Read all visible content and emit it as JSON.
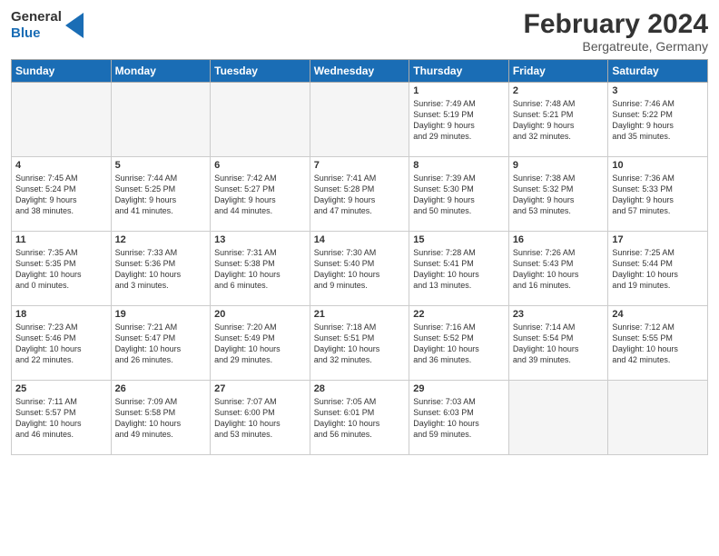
{
  "header": {
    "logo_line1": "General",
    "logo_line2": "Blue",
    "month": "February 2024",
    "location": "Bergatreute, Germany"
  },
  "days_of_week": [
    "Sunday",
    "Monday",
    "Tuesday",
    "Wednesday",
    "Thursday",
    "Friday",
    "Saturday"
  ],
  "weeks": [
    [
      {
        "day": "",
        "info": ""
      },
      {
        "day": "",
        "info": ""
      },
      {
        "day": "",
        "info": ""
      },
      {
        "day": "",
        "info": ""
      },
      {
        "day": "1",
        "info": "Sunrise: 7:49 AM\nSunset: 5:19 PM\nDaylight: 9 hours\nand 29 minutes."
      },
      {
        "day": "2",
        "info": "Sunrise: 7:48 AM\nSunset: 5:21 PM\nDaylight: 9 hours\nand 32 minutes."
      },
      {
        "day": "3",
        "info": "Sunrise: 7:46 AM\nSunset: 5:22 PM\nDaylight: 9 hours\nand 35 minutes."
      }
    ],
    [
      {
        "day": "4",
        "info": "Sunrise: 7:45 AM\nSunset: 5:24 PM\nDaylight: 9 hours\nand 38 minutes."
      },
      {
        "day": "5",
        "info": "Sunrise: 7:44 AM\nSunset: 5:25 PM\nDaylight: 9 hours\nand 41 minutes."
      },
      {
        "day": "6",
        "info": "Sunrise: 7:42 AM\nSunset: 5:27 PM\nDaylight: 9 hours\nand 44 minutes."
      },
      {
        "day": "7",
        "info": "Sunrise: 7:41 AM\nSunset: 5:28 PM\nDaylight: 9 hours\nand 47 minutes."
      },
      {
        "day": "8",
        "info": "Sunrise: 7:39 AM\nSunset: 5:30 PM\nDaylight: 9 hours\nand 50 minutes."
      },
      {
        "day": "9",
        "info": "Sunrise: 7:38 AM\nSunset: 5:32 PM\nDaylight: 9 hours\nand 53 minutes."
      },
      {
        "day": "10",
        "info": "Sunrise: 7:36 AM\nSunset: 5:33 PM\nDaylight: 9 hours\nand 57 minutes."
      }
    ],
    [
      {
        "day": "11",
        "info": "Sunrise: 7:35 AM\nSunset: 5:35 PM\nDaylight: 10 hours\nand 0 minutes."
      },
      {
        "day": "12",
        "info": "Sunrise: 7:33 AM\nSunset: 5:36 PM\nDaylight: 10 hours\nand 3 minutes."
      },
      {
        "day": "13",
        "info": "Sunrise: 7:31 AM\nSunset: 5:38 PM\nDaylight: 10 hours\nand 6 minutes."
      },
      {
        "day": "14",
        "info": "Sunrise: 7:30 AM\nSunset: 5:40 PM\nDaylight: 10 hours\nand 9 minutes."
      },
      {
        "day": "15",
        "info": "Sunrise: 7:28 AM\nSunset: 5:41 PM\nDaylight: 10 hours\nand 13 minutes."
      },
      {
        "day": "16",
        "info": "Sunrise: 7:26 AM\nSunset: 5:43 PM\nDaylight: 10 hours\nand 16 minutes."
      },
      {
        "day": "17",
        "info": "Sunrise: 7:25 AM\nSunset: 5:44 PM\nDaylight: 10 hours\nand 19 minutes."
      }
    ],
    [
      {
        "day": "18",
        "info": "Sunrise: 7:23 AM\nSunset: 5:46 PM\nDaylight: 10 hours\nand 22 minutes."
      },
      {
        "day": "19",
        "info": "Sunrise: 7:21 AM\nSunset: 5:47 PM\nDaylight: 10 hours\nand 26 minutes."
      },
      {
        "day": "20",
        "info": "Sunrise: 7:20 AM\nSunset: 5:49 PM\nDaylight: 10 hours\nand 29 minutes."
      },
      {
        "day": "21",
        "info": "Sunrise: 7:18 AM\nSunset: 5:51 PM\nDaylight: 10 hours\nand 32 minutes."
      },
      {
        "day": "22",
        "info": "Sunrise: 7:16 AM\nSunset: 5:52 PM\nDaylight: 10 hours\nand 36 minutes."
      },
      {
        "day": "23",
        "info": "Sunrise: 7:14 AM\nSunset: 5:54 PM\nDaylight: 10 hours\nand 39 minutes."
      },
      {
        "day": "24",
        "info": "Sunrise: 7:12 AM\nSunset: 5:55 PM\nDaylight: 10 hours\nand 42 minutes."
      }
    ],
    [
      {
        "day": "25",
        "info": "Sunrise: 7:11 AM\nSunset: 5:57 PM\nDaylight: 10 hours\nand 46 minutes."
      },
      {
        "day": "26",
        "info": "Sunrise: 7:09 AM\nSunset: 5:58 PM\nDaylight: 10 hours\nand 49 minutes."
      },
      {
        "day": "27",
        "info": "Sunrise: 7:07 AM\nSunset: 6:00 PM\nDaylight: 10 hours\nand 53 minutes."
      },
      {
        "day": "28",
        "info": "Sunrise: 7:05 AM\nSunset: 6:01 PM\nDaylight: 10 hours\nand 56 minutes."
      },
      {
        "day": "29",
        "info": "Sunrise: 7:03 AM\nSunset: 6:03 PM\nDaylight: 10 hours\nand 59 minutes."
      },
      {
        "day": "",
        "info": ""
      },
      {
        "day": "",
        "info": ""
      }
    ]
  ]
}
